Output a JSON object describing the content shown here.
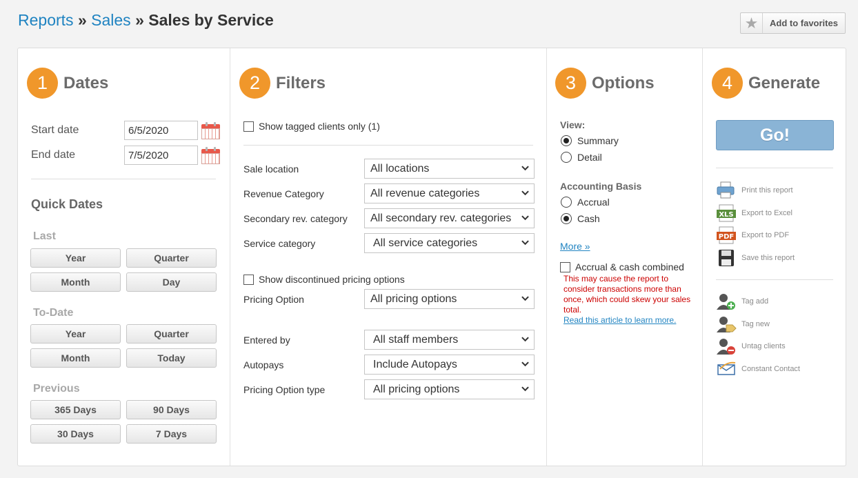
{
  "breadcrumb": {
    "reports": "Reports",
    "sales": "Sales",
    "sep": "»",
    "current": "Sales by Service"
  },
  "favorites": {
    "label": "Add to favorites",
    "icon": "star-icon"
  },
  "dates": {
    "step": "1",
    "title": "Dates",
    "start_label": "Start date",
    "start_value": "6/5/2020",
    "end_label": "End date",
    "end_value": "7/5/2020",
    "quick_title": "Quick Dates",
    "last": {
      "label": "Last",
      "buttons": [
        "Year",
        "Quarter",
        "Month",
        "Day"
      ]
    },
    "to_date": {
      "label": "To-Date",
      "buttons": [
        "Year",
        "Quarter",
        "Month",
        "Today"
      ]
    },
    "previous": {
      "label": "Previous",
      "buttons": [
        "365 Days",
        "90 Days",
        "30 Days",
        "7 Days"
      ]
    }
  },
  "filters": {
    "step": "2",
    "title": "Filters",
    "tagged": "Show tagged clients only (1)",
    "sale_location": {
      "label": "Sale location",
      "value": "All locations"
    },
    "revenue_category": {
      "label": "Revenue Category",
      "value": "All revenue categories"
    },
    "secondary_rev": {
      "label": "Secondary rev. category",
      "value": "All secondary rev. categories"
    },
    "service_category": {
      "label": "Service category",
      "value": "All service categories"
    },
    "discontinued": "Show discontinued pricing options",
    "pricing_option": {
      "label": "Pricing Option",
      "value": "All pricing options"
    },
    "entered_by": {
      "label": "Entered by",
      "value": "All staff members"
    },
    "autopays": {
      "label": "Autopays",
      "value": "Include Autopays"
    },
    "pricing_option_type": {
      "label": "Pricing Option type",
      "value": "All pricing options"
    }
  },
  "options": {
    "step": "3",
    "title": "Options",
    "view_label": "View:",
    "summary": "Summary",
    "detail": "Detail",
    "basis_label": "Accounting Basis",
    "accrual": "Accrual",
    "cash": "Cash",
    "more": "More »",
    "combined": "Accrual & cash combined",
    "warning": "This may cause the report to consider transactions more than once, which could skew your sales total.",
    "article_link": "Read this article to learn more."
  },
  "generate": {
    "step": "4",
    "title": "Generate",
    "go": "Go!",
    "print": "Print this report",
    "excel": "Export to Excel",
    "pdf": "Export to PDF",
    "save": "Save this report",
    "tag_add": "Tag add",
    "tag_new": "Tag new",
    "untag": "Untag clients",
    "constant_contact": "Constant Contact"
  },
  "colors": {
    "accent": "#f0972b",
    "link": "#1f83c1",
    "go": "#8ab4d6",
    "warning": "#cc0000"
  }
}
